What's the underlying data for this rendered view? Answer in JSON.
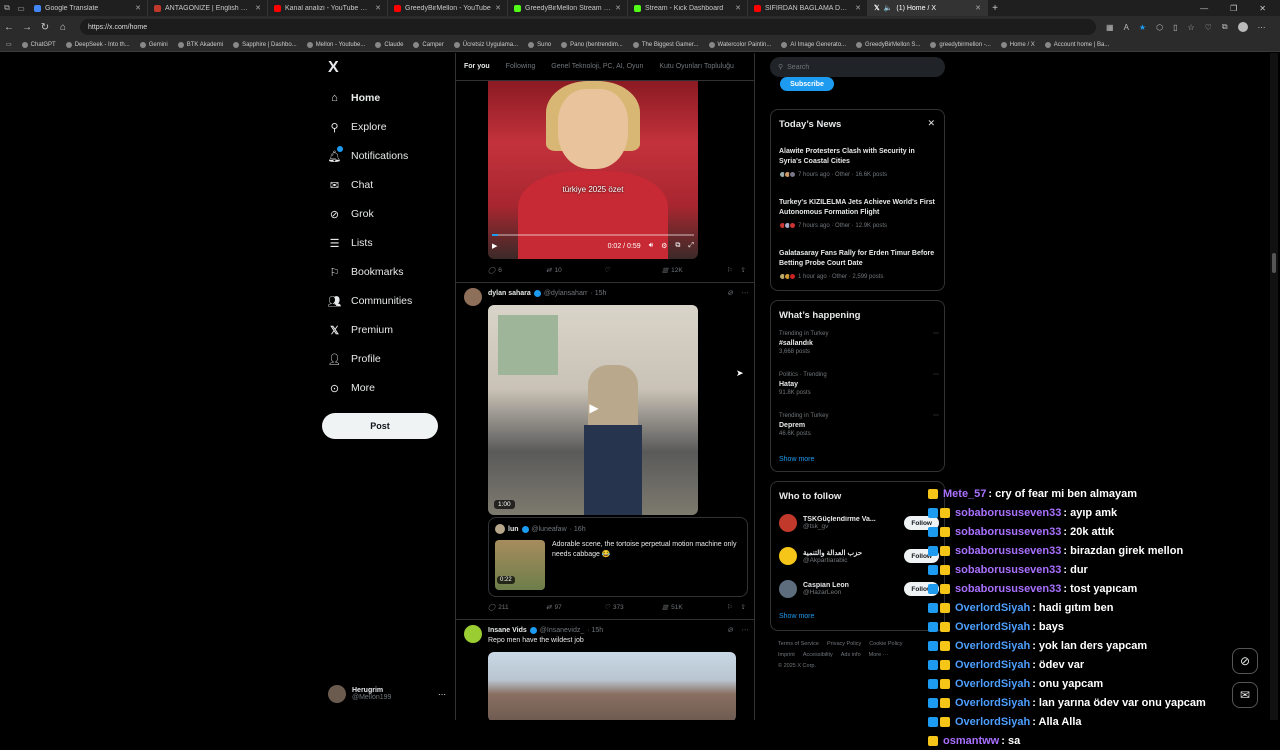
{
  "browser": {
    "tabs": [
      {
        "title": "Google Translate",
        "color": "#4285f4"
      },
      {
        "title": "ANTAGONIZE | English meaning",
        "color": "#c0392b"
      },
      {
        "title": "Kanal analizi - YouTube Studio",
        "color": "#ff0000"
      },
      {
        "title": "GreedyBirMellon - YouTube",
        "color": "#ff0000"
      },
      {
        "title": "GreedyBirMellon Stream - Watch",
        "color": "#53fc18"
      },
      {
        "title": "Stream - Kick Dashboard",
        "color": "#53fc18"
      },
      {
        "title": "SIFIRDAN BAĞLAMA DERSİ 3 (EN",
        "color": "#ff0000"
      },
      {
        "title": "(1) Home / X",
        "color": "#ffffff",
        "active": true
      }
    ],
    "url": "https://x.com/home",
    "bookmarks": [
      "ChatGPT",
      "DeepSeek - Into th...",
      "Gemini",
      "BTK Akademi",
      "Sapphire | Dashbo...",
      "Mellon - Youtube...",
      "Claude",
      "Camper",
      "Ücretsiz Uygulama...",
      "Suno",
      "Pano (bentrendim...",
      "The Biggest Gamer...",
      "Watercolor Paintin...",
      "AI Image Generato...",
      "GreedyBirMellon S...",
      "greedybirmellon -...",
      "Home / X",
      "Account home | Ba..."
    ]
  },
  "sidebar": {
    "logo": "X",
    "items": [
      {
        "label": "Home",
        "icon": "home-icon"
      },
      {
        "label": "Explore",
        "icon": "search-icon"
      },
      {
        "label": "Notifications",
        "icon": "bell-icon"
      },
      {
        "label": "Chat",
        "icon": "mail-icon"
      },
      {
        "label": "Grok",
        "icon": "grok-icon"
      },
      {
        "label": "Lists",
        "icon": "list-icon"
      },
      {
        "label": "Bookmarks",
        "icon": "bookmark-icon"
      },
      {
        "label": "Communities",
        "icon": "people-icon"
      },
      {
        "label": "Premium",
        "icon": "x-icon"
      },
      {
        "label": "Profile",
        "icon": "user-icon"
      },
      {
        "label": "More",
        "icon": "more-circle-icon"
      }
    ],
    "post_label": "Post",
    "account": {
      "name": "Herugrim",
      "handle": "@Mellon199"
    }
  },
  "feed": {
    "tabs": [
      "For you",
      "Following",
      "Genel Teknoloji, PC, AI, Oyun",
      "Kutu Oyunları Topluluğu"
    ],
    "post1": {
      "video_caption": "türkiye 2025 özet",
      "time": "0:02 / 0:59",
      "progress": 0.03,
      "replies": "6",
      "reposts": "10",
      "likes": "",
      "views": "12K"
    },
    "post2": {
      "name": "dylan sahara",
      "handle": "@dylansaharr",
      "age": "· 15h",
      "duration": "1:00",
      "quote": {
        "name": "lun",
        "handle": "@luneafaw",
        "age": "· 16h",
        "text": "Adorable scene, the tortoise perpetual motion machine only needs cabbage 😂",
        "duration": "0:22"
      },
      "replies": "211",
      "reposts": "97",
      "likes": "373",
      "views": "51K"
    },
    "post3": {
      "name": "Insane Vids",
      "handle": "@Insanevidz_",
      "age": "· 15h",
      "text": "Repo men have the wildest job"
    }
  },
  "right": {
    "search_placeholder": "Search",
    "subscribe_label": "Subscribe",
    "news_title": "Today’s News",
    "news": [
      {
        "title": "Alawite Protesters Clash with Security in Syria's Coastal Cities",
        "meta": "7 hours ago · Other · 16.6K posts"
      },
      {
        "title": "Turkey's KIZILELMA Jets Achieve World's First Autonomous Formation Flight",
        "meta": "7 hours ago · Other · 12.9K posts"
      },
      {
        "title": "Galatasaray Fans Rally for Erden Timur Before Betting Probe Court Date",
        "meta": "1 hour ago · Other · 2,599 posts"
      }
    ],
    "happening_title": "What’s happening",
    "trends": [
      {
        "context": "Trending in Turkey",
        "name": "#sallandık",
        "count": "3,668 posts"
      },
      {
        "context": "Politics · Trending",
        "name": "Hatay",
        "count": "91.8K posts"
      },
      {
        "context": "Trending in Turkey",
        "name": "Deprem",
        "count": "46.6K posts"
      }
    ],
    "show_more": "Show more",
    "wtf_title": "Who to follow",
    "follow": [
      {
        "name": "TSKGüçlendirme Va...",
        "handle": "@tsk_gv",
        "color": "#c0392b"
      },
      {
        "name": "حزب العدالة والتنمية",
        "handle": "@Akpartiarabic",
        "color": "#f5c518"
      },
      {
        "name": "Caspian Leon",
        "handle": "@HazarLeon",
        "color": "#5d6d7e"
      }
    ],
    "follow_label": "Follow",
    "footer": [
      "Terms of Service",
      "Privacy Policy",
      "Cookie Policy",
      "Imprint",
      "Accessibility",
      "Ads info",
      "More ···",
      "© 2025 X Corp."
    ]
  },
  "chat": [
    {
      "user": "Mete_57",
      "msg": ": cry of fear mi ben almayam",
      "color": "#a970ff"
    },
    {
      "user": "sobaborususeven33",
      "msg": ": ayıp amk",
      "color": "#a970ff"
    },
    {
      "user": "sobaborususeven33",
      "msg": ": 20k attık",
      "color": "#a970ff"
    },
    {
      "user": "sobaborususeven33",
      "msg": ": birazdan girek mellon",
      "color": "#a970ff"
    },
    {
      "user": "sobaborususeven33",
      "msg": ": dur",
      "color": "#a970ff"
    },
    {
      "user": "sobaborususeven33",
      "msg": ": tost yapıcam",
      "color": "#a970ff"
    },
    {
      "user": "OverlordSiyah",
      "msg": ": hadi gıtım ben",
      "color": "#4d9fff"
    },
    {
      "user": "OverlordSiyah",
      "msg": ": bays",
      "color": "#4d9fff"
    },
    {
      "user": "OverlordSiyah",
      "msg": ": yok lan ders yapcam",
      "color": "#4d9fff"
    },
    {
      "user": "OverlordSiyah",
      "msg": ": ödev var",
      "color": "#4d9fff"
    },
    {
      "user": "OverlordSiyah",
      "msg": ": onu yapcam",
      "color": "#4d9fff"
    },
    {
      "user": "OverlordSiyah",
      "msg": ": lan yarına ödev var onu yapcam",
      "color": "#4d9fff"
    },
    {
      "user": "OverlordSiyah",
      "msg": ": Alla Alla",
      "color": "#4d9fff"
    },
    {
      "user": "osmantww",
      "msg": ": sa",
      "color": "#a970ff"
    }
  ]
}
